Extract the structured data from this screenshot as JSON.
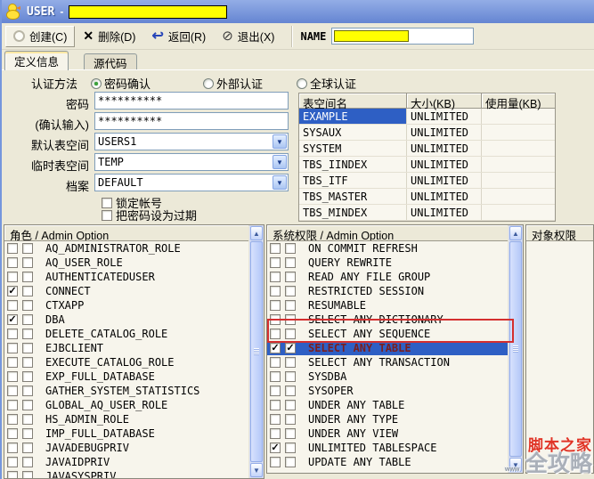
{
  "window": {
    "title": "USER",
    "title_separator": "-",
    "title_input_value": ""
  },
  "toolbar": {
    "create_label": "创建(C)",
    "delete_label": "删除(D)",
    "back_label": "返回(R)",
    "exit_label": "退出(X)",
    "name_label": "NAME",
    "name_value": ""
  },
  "tabs": {
    "definition": "定义信息",
    "source": "源代码"
  },
  "form": {
    "auth_label": "认证方法",
    "auth_options": [
      {
        "label": "密码确认",
        "selected": true
      },
      {
        "label": "外部认证",
        "selected": false
      },
      {
        "label": "全球认证",
        "selected": false
      }
    ],
    "password_label": "密码",
    "password_value": "**********",
    "confirm_label": "(确认输入)",
    "confirm_value": "**********",
    "default_ts_label": "默认表空间",
    "default_ts_value": "USERS1",
    "temp_ts_label": "临时表空间",
    "temp_ts_value": "TEMP",
    "profile_label": "档案",
    "profile_value": "DEFAULT",
    "lock_label": "锁定帐号",
    "expire_label": "把密码设为过期"
  },
  "tablespace_table": {
    "columns": [
      "表空间名",
      "大小(KB)",
      "使用量(KB)"
    ],
    "rows": [
      {
        "name": "EXAMPLE",
        "size": "UNLIMITED",
        "used": "",
        "selected": true
      },
      {
        "name": "SYSAUX",
        "size": "UNLIMITED",
        "used": "",
        "selected": false
      },
      {
        "name": "SYSTEM",
        "size": "UNLIMITED",
        "used": "",
        "selected": false
      },
      {
        "name": "TBS_IINDEX",
        "size": "UNLIMITED",
        "used": "",
        "selected": false
      },
      {
        "name": "TBS_ITF",
        "size": "UNLIMITED",
        "used": "",
        "selected": false
      },
      {
        "name": "TBS_MASTER",
        "size": "UNLIMITED",
        "used": "",
        "selected": false
      },
      {
        "name": "TBS_MINDEX",
        "size": "UNLIMITED",
        "used": "",
        "selected": false
      }
    ]
  },
  "roles_panel": {
    "header": "角色 / Admin Option",
    "items": [
      {
        "label": "AQ_ADMINISTRATOR_ROLE",
        "granted": false,
        "admin": false
      },
      {
        "label": "AQ_USER_ROLE",
        "granted": false,
        "admin": false
      },
      {
        "label": "AUTHENTICATEDUSER",
        "granted": false,
        "admin": false
      },
      {
        "label": "CONNECT",
        "granted": true,
        "admin": false
      },
      {
        "label": "CTXAPP",
        "granted": false,
        "admin": false
      },
      {
        "label": "DBA",
        "granted": true,
        "admin": false
      },
      {
        "label": "DELETE_CATALOG_ROLE",
        "granted": false,
        "admin": false
      },
      {
        "label": "EJBCLIENT",
        "granted": false,
        "admin": false
      },
      {
        "label": "EXECUTE_CATALOG_ROLE",
        "granted": false,
        "admin": false
      },
      {
        "label": "EXP_FULL_DATABASE",
        "granted": false,
        "admin": false
      },
      {
        "label": "GATHER_SYSTEM_STATISTICS",
        "granted": false,
        "admin": false
      },
      {
        "label": "GLOBAL_AQ_USER_ROLE",
        "granted": false,
        "admin": false
      },
      {
        "label": "HS_ADMIN_ROLE",
        "granted": false,
        "admin": false
      },
      {
        "label": "IMP_FULL_DATABASE",
        "granted": false,
        "admin": false
      },
      {
        "label": "JAVADEBUGPRIV",
        "granted": false,
        "admin": false
      },
      {
        "label": "JAVAIDPRIV",
        "granted": false,
        "admin": false
      },
      {
        "label": "JAVASYSPRIV",
        "granted": false,
        "admin": false
      }
    ]
  },
  "sysprivs_panel": {
    "header": "系统权限 / Admin Option",
    "items": [
      {
        "label": "ON COMMIT REFRESH",
        "granted": false,
        "admin": false,
        "selected": false
      },
      {
        "label": "QUERY REWRITE",
        "granted": false,
        "admin": false,
        "selected": false
      },
      {
        "label": "READ ANY FILE GROUP",
        "granted": false,
        "admin": false,
        "selected": false
      },
      {
        "label": "RESTRICTED SESSION",
        "granted": false,
        "admin": false,
        "selected": false
      },
      {
        "label": "RESUMABLE",
        "granted": false,
        "admin": false,
        "selected": false
      },
      {
        "label": "SELECT ANY DICTIONARY",
        "granted": false,
        "admin": false,
        "selected": false
      },
      {
        "label": "SELECT ANY SEQUENCE",
        "granted": false,
        "admin": false,
        "selected": false
      },
      {
        "label": "SELECT ANY TABLE",
        "granted": true,
        "admin": true,
        "selected": true
      },
      {
        "label": "SELECT ANY TRANSACTION",
        "granted": false,
        "admin": false,
        "selected": false
      },
      {
        "label": "SYSDBA",
        "granted": false,
        "admin": false,
        "selected": false
      },
      {
        "label": "SYSOPER",
        "granted": false,
        "admin": false,
        "selected": false
      },
      {
        "label": "UNDER ANY TABLE",
        "granted": false,
        "admin": false,
        "selected": false
      },
      {
        "label": "UNDER ANY TYPE",
        "granted": false,
        "admin": false,
        "selected": false
      },
      {
        "label": "UNDER ANY VIEW",
        "granted": false,
        "admin": false,
        "selected": false
      },
      {
        "label": "UNLIMITED TABLESPACE",
        "granted": true,
        "admin": false,
        "selected": false
      },
      {
        "label": "UPDATE ANY TABLE",
        "granted": false,
        "admin": false,
        "selected": false
      }
    ]
  },
  "objprivs_panel": {
    "header": "对象权限"
  },
  "watermark": {
    "line1": "脚本之家",
    "line2": "全攻略",
    "sub": "www"
  },
  "colors": {
    "selection": "#2e5fc4",
    "highlight_box": "#d42f2f",
    "field_yellow": "#ffff00"
  }
}
